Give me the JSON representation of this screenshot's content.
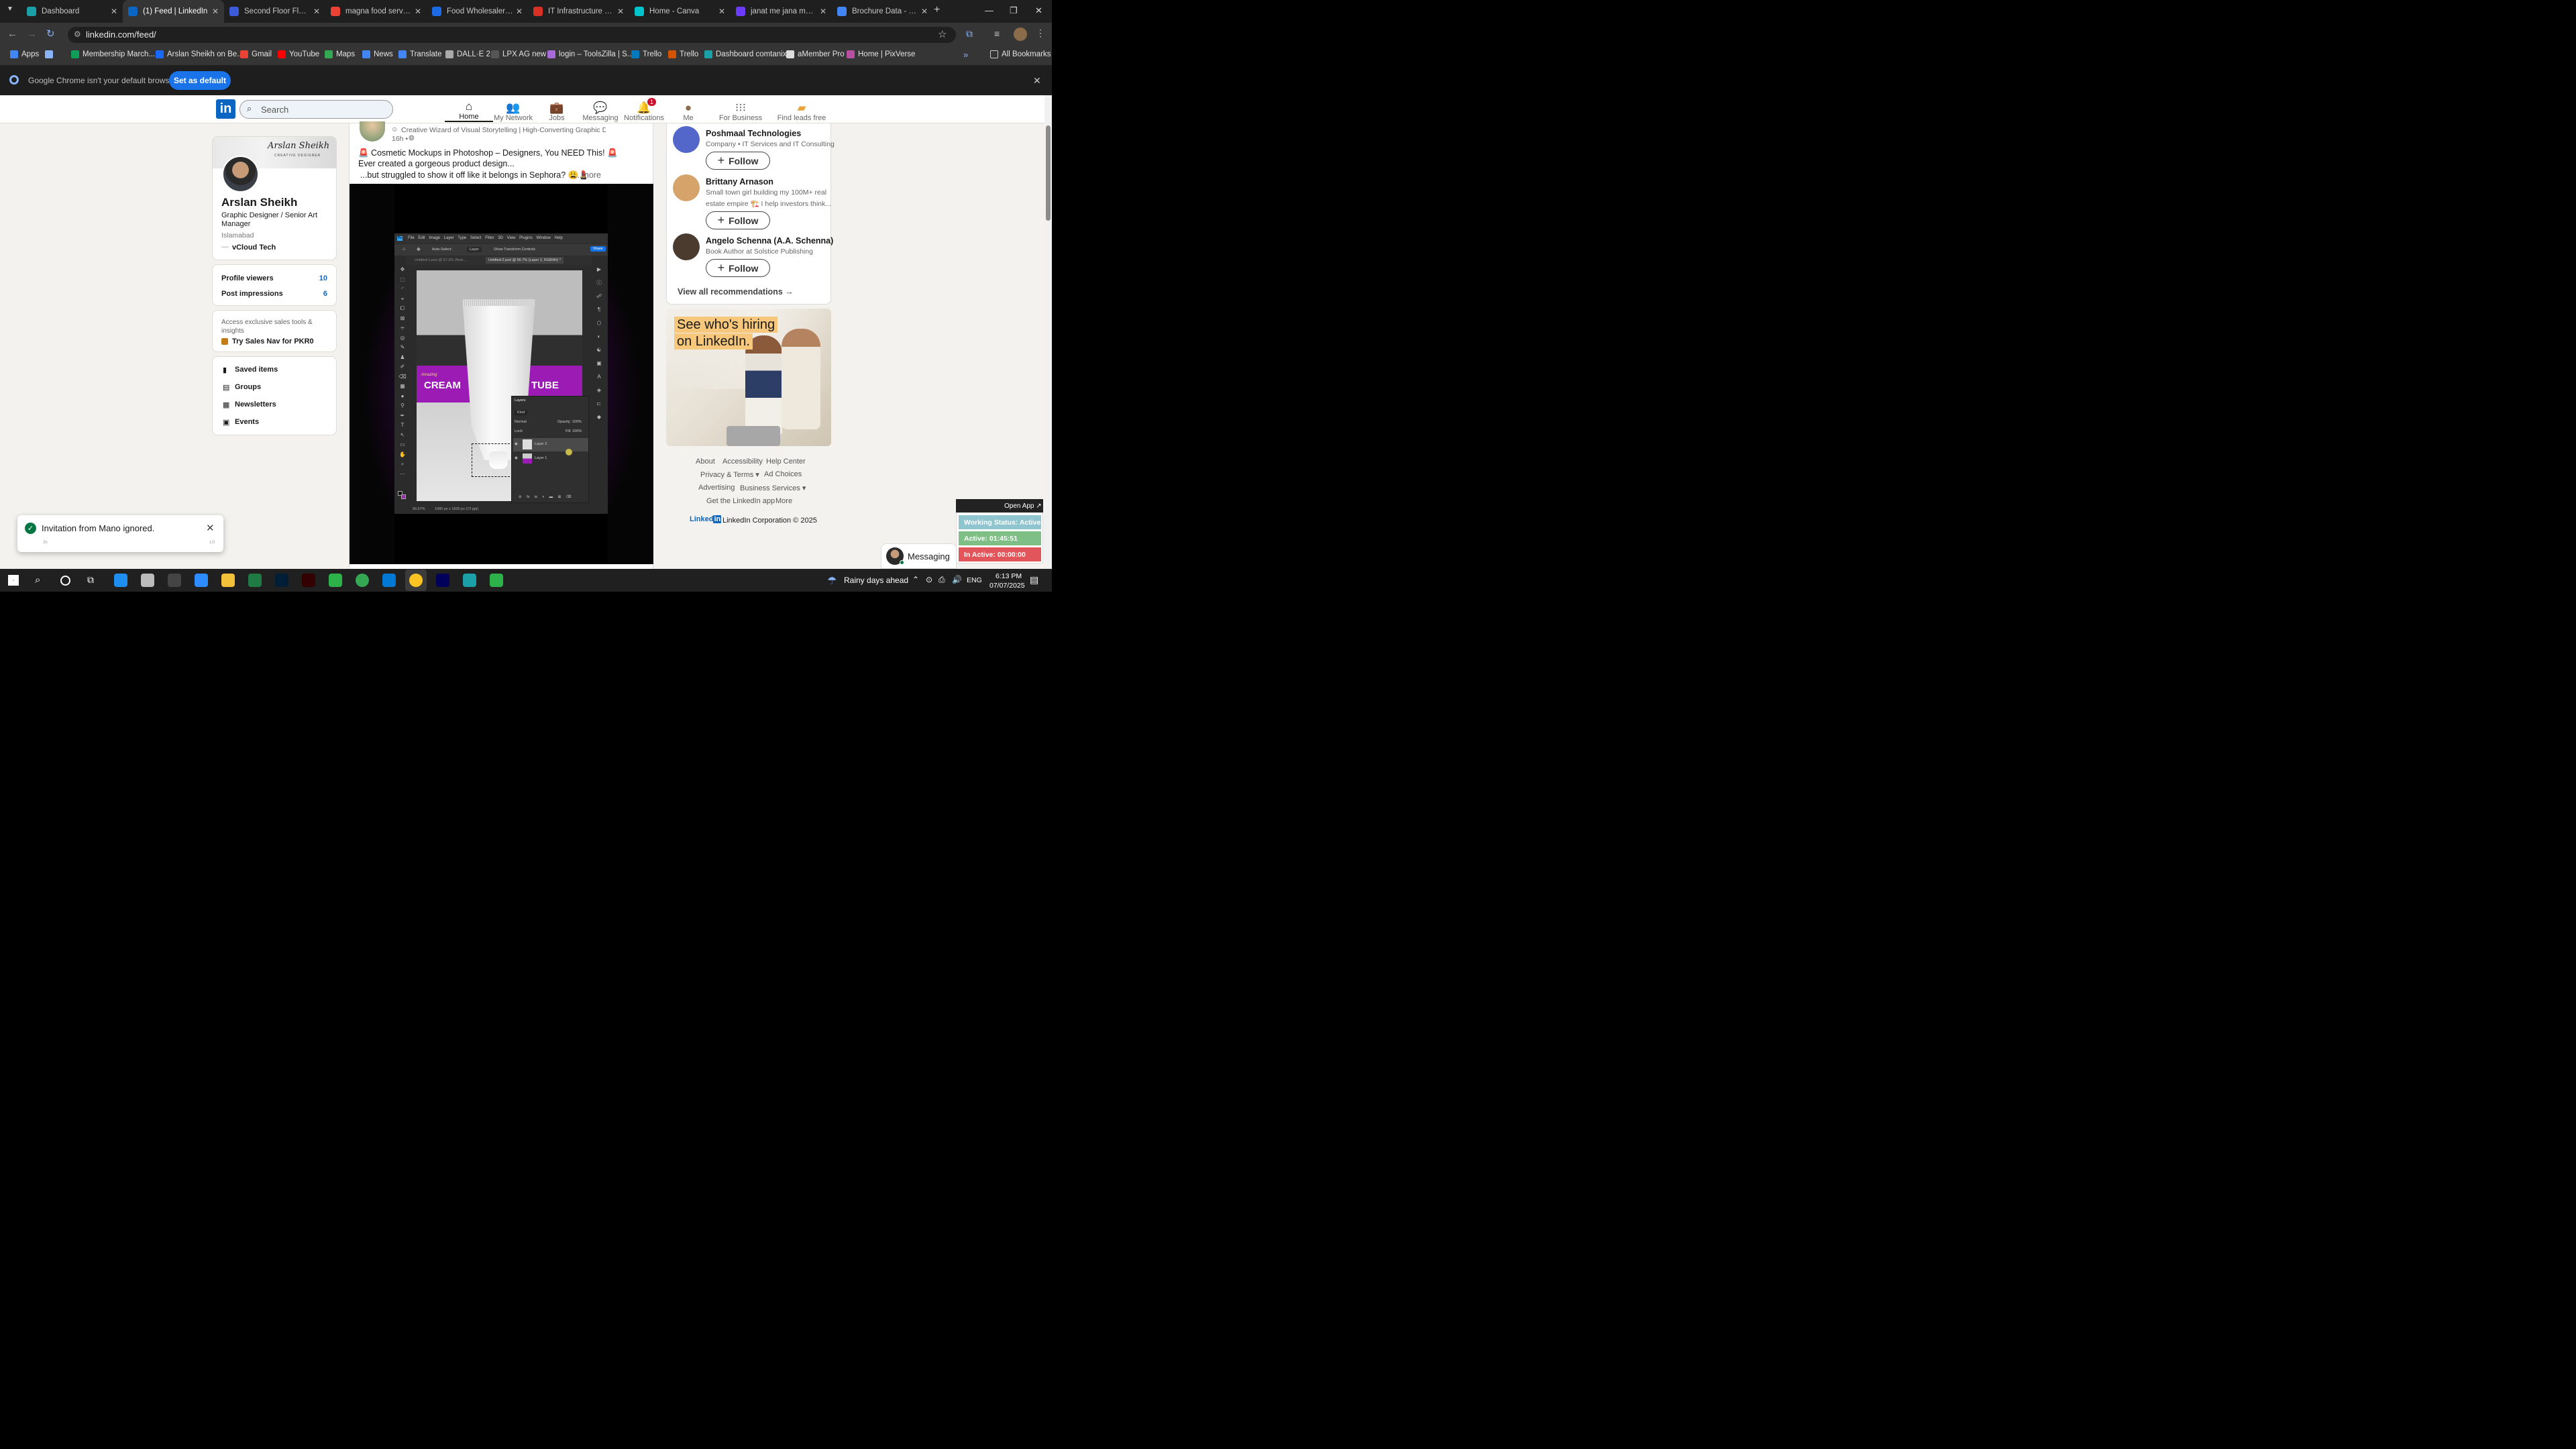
{
  "browser": {
    "tabs": [
      {
        "title": "Dashboard",
        "icon_color": "#1ba0a8"
      },
      {
        "title": "(1) Feed | LinkedIn",
        "icon_color": "#0a66c2"
      },
      {
        "title": "Second Floor Flat For",
        "icon_color": "#3b5bdb"
      },
      {
        "title": "magna food service",
        "icon_color": "#ea4335"
      },
      {
        "title": "Food Wholesaler | Ha",
        "icon_color": "#1d6ae5"
      },
      {
        "title": "IT Infrastructure & Cy",
        "icon_color": "#d93025"
      },
      {
        "title": "Home - Canva",
        "icon_color": "#00c4cc"
      },
      {
        "title": "janat me jana mumkin",
        "icon_color": "#6b3cff"
      },
      {
        "title": "Brochure Data - Goo",
        "icon_color": "#4285f4"
      }
    ],
    "url": "linkedin.com/feed/",
    "bookmarks": [
      {
        "label": "Apps",
        "color": "#4285f4"
      },
      {
        "label": "",
        "color": "#8ab4f8"
      },
      {
        "label": "Membership March...",
        "color": "#0f9d58"
      },
      {
        "label": "Arslan Sheikh on Be...",
        "color": "#1769ff"
      },
      {
        "label": "Gmail",
        "color": "#ea4335"
      },
      {
        "label": "YouTube",
        "color": "#ff0000"
      },
      {
        "label": "Maps",
        "color": "#34a853"
      },
      {
        "label": "News",
        "color": "#4285f4"
      },
      {
        "label": "Translate",
        "color": "#4285f4"
      },
      {
        "label": "DALL·E 2",
        "color": "#aaaaaa"
      },
      {
        "label": "LPX AG new",
        "color": "#555555"
      },
      {
        "label": "login – ToolsZilla | S...",
        "color": "#a86bd9"
      },
      {
        "label": "Trello",
        "color": "#0079bf"
      },
      {
        "label": "Trello",
        "color": "#d35400"
      },
      {
        "label": "Dashboard comtanix",
        "color": "#1ba0a8"
      },
      {
        "label": "aMember Pro",
        "color": "#dddddd"
      },
      {
        "label": "Home | PixVerse",
        "color": "#b84fa0"
      }
    ],
    "all_bookmarks": "All Bookmarks",
    "infobar_text": "Google Chrome isn't your default browser",
    "infobar_button": "Set as default"
  },
  "linkedin": {
    "search_placeholder": "Search",
    "nav": [
      {
        "label": "Home",
        "icon": "home-icon"
      },
      {
        "label": "My Network",
        "icon": "network-icon"
      },
      {
        "label": "Jobs",
        "icon": "briefcase-icon"
      },
      {
        "label": "Messaging",
        "icon": "chat-icon"
      },
      {
        "label": "Notifications",
        "icon": "bell-icon",
        "badge": "1"
      },
      {
        "label": "Me",
        "icon": "avatar-icon"
      },
      {
        "label": "For Business",
        "icon": "grid-icon"
      },
      {
        "label": "Find leads free",
        "icon": "leads-icon"
      }
    ],
    "profile": {
      "name": "Arslan Sheikh",
      "banner_name": "Arslan Sheikh",
      "banner_sub": "CREATIVE DESIGNER",
      "headline": "Graphic Designer / Senior Art Manager",
      "location": "Islamabad",
      "company": "vCloud Tech",
      "stats": [
        {
          "label": "Profile viewers",
          "value": "10"
        },
        {
          "label": "Post impressions",
          "value": "6"
        }
      ],
      "premium_text": "Access exclusive sales tools & insights",
      "premium_cta": "Try Sales Nav for PKR0",
      "links": [
        "Saved items",
        "Groups",
        "Newsletters",
        "Events"
      ]
    },
    "post": {
      "author_headline": "Creative Wizard of Visual Storytelling | High-Converting Graphic Des...",
      "time": "16h •",
      "line1": "🚨 Cosmetic Mockups in Photoshop – Designers, You NEED This! 🚨",
      "line2": "Ever created a gorgeous product design...",
      "line3": "...but struggled to show it off like it belongs in Sephora? 😩💄",
      "more": "...more",
      "mockup": {
        "menu": [
          "File",
          "Edit",
          "Image",
          "Layer",
          "Type",
          "Select",
          "Filter",
          "3D",
          "View",
          "Plugins",
          "Window",
          "Help"
        ],
        "share": "Share",
        "doc_tab_1": "Untitled-1.psd @ 57.3% (Nois...",
        "doc_tab_2": "Untitled-2.psd @ 56.7% (Layer 2, RGB/8#) *",
        "auto_select": "Auto-Select:",
        "layer_opt": "Layer",
        "transform": "Show Transform Controls",
        "text_left": "CREAM",
        "text_right": "TUBE",
        "script_text": "Amazing",
        "layers_title": "Layers",
        "kind": "Kind",
        "normal": "Normal",
        "opacity": "Opacity: 100%",
        "fill": "Fill: 100%",
        "lock": "Lock:",
        "layer2": "Layer 2",
        "layer1": "Layer 1",
        "zoom": "56.67%",
        "dims": "1080 px x 1500 px (72 ppi)"
      }
    },
    "recommendations": [
      {
        "name": "Poshmaal Technologies",
        "desc1": "Company • IT Services and IT Consulting",
        "desc2": "",
        "avatar_color": "#5267c9"
      },
      {
        "name": "Brittany Arnason",
        "desc1": "Small town girl building my 100M+ real",
        "desc2": "estate empire 🏗️ I help investors think...",
        "avatar_color": "#d6a36a"
      },
      {
        "name": "Angelo Schenna (A.A. Schenna)",
        "desc1": "Book Author at Solstice Publishing",
        "desc2": "",
        "avatar_color": "#4a3b2e"
      }
    ],
    "follow_label": "Follow",
    "view_all": "View all recommendations →",
    "ad": {
      "line1": "See who's hiring",
      "line2": "on LinkedIn."
    },
    "footer": {
      "row1": [
        "About",
        "Accessibility",
        "Help Center"
      ],
      "row2": [
        "Privacy & Terms ▾",
        "Ad Choices"
      ],
      "row3": [
        "Advertising",
        "Business Services ▾"
      ],
      "row4": [
        "Get the LinkedIn app",
        "More"
      ],
      "copyright": "LinkedIn Corporation © 2025"
    },
    "toast": {
      "text": "Invitation from Mano ignored.",
      "left_meta": "2h",
      "right_meta": "1/3"
    },
    "messaging": "Messaging"
  },
  "tracker": {
    "open_app": "Open App ↗",
    "status": "Working Status: Active",
    "active": "Active: 01:45:51",
    "inactive": "In Active: 00:00:00"
  },
  "taskbar": {
    "weather": "Rainy days ahead",
    "lang": "ENG",
    "time": "6:13 PM",
    "date": "07/07/2025"
  }
}
